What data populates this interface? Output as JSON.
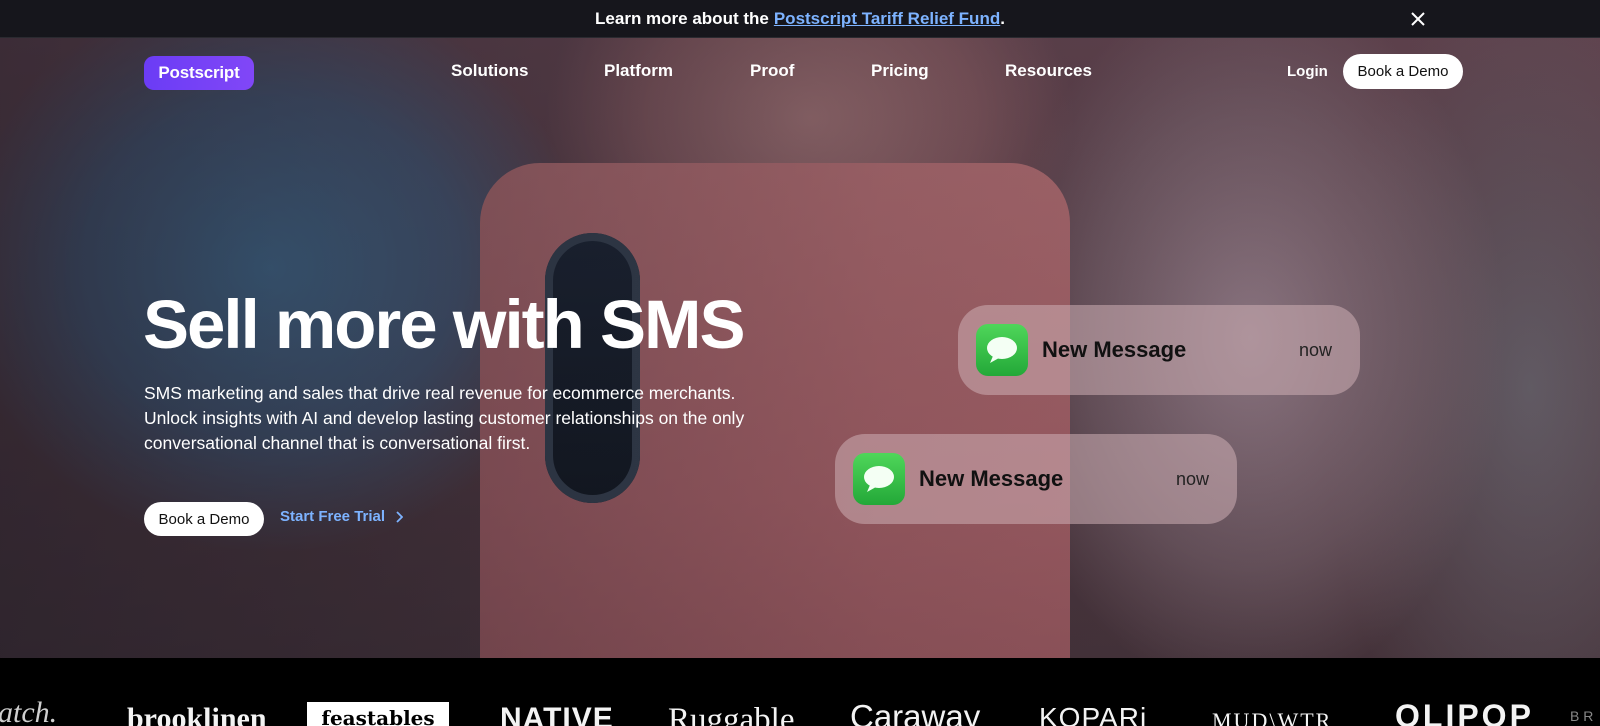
{
  "announcement": {
    "prefix": "Learn more about the",
    "link": "Postscript Tariff Relief Fund",
    "suffix": "."
  },
  "nav": {
    "logo": "Postscript",
    "items": [
      "Solutions",
      "Platform",
      "Proof",
      "Pricing",
      "Resources"
    ],
    "login": "Login",
    "cta": "Book a Demo"
  },
  "hero": {
    "title": "Sell more with SMS",
    "subtitle": "SMS marketing and sales that drive real revenue for ecommerce merchants. Unlock insights with AI and develop lasting customer relationships on the only conversational channel that is conversational first.",
    "primary_cta": "Book a Demo",
    "secondary_cta": "Start Free Trial"
  },
  "notifications": [
    {
      "title": "New Message",
      "time": "now"
    },
    {
      "title": "New Message",
      "time": "now"
    }
  ],
  "brands": [
    "atch.",
    "brooklinen",
    "feastables",
    "NATIVE",
    "Ruggable",
    "Caraway",
    "KOPARi",
    "MUD\\WTR",
    "OLIPOP",
    "B R"
  ],
  "colors": {
    "accent": "#7db3ff",
    "logo": "#6b3cf5",
    "announcement_bg": "#16161c",
    "message_app": "#2fbf45"
  }
}
